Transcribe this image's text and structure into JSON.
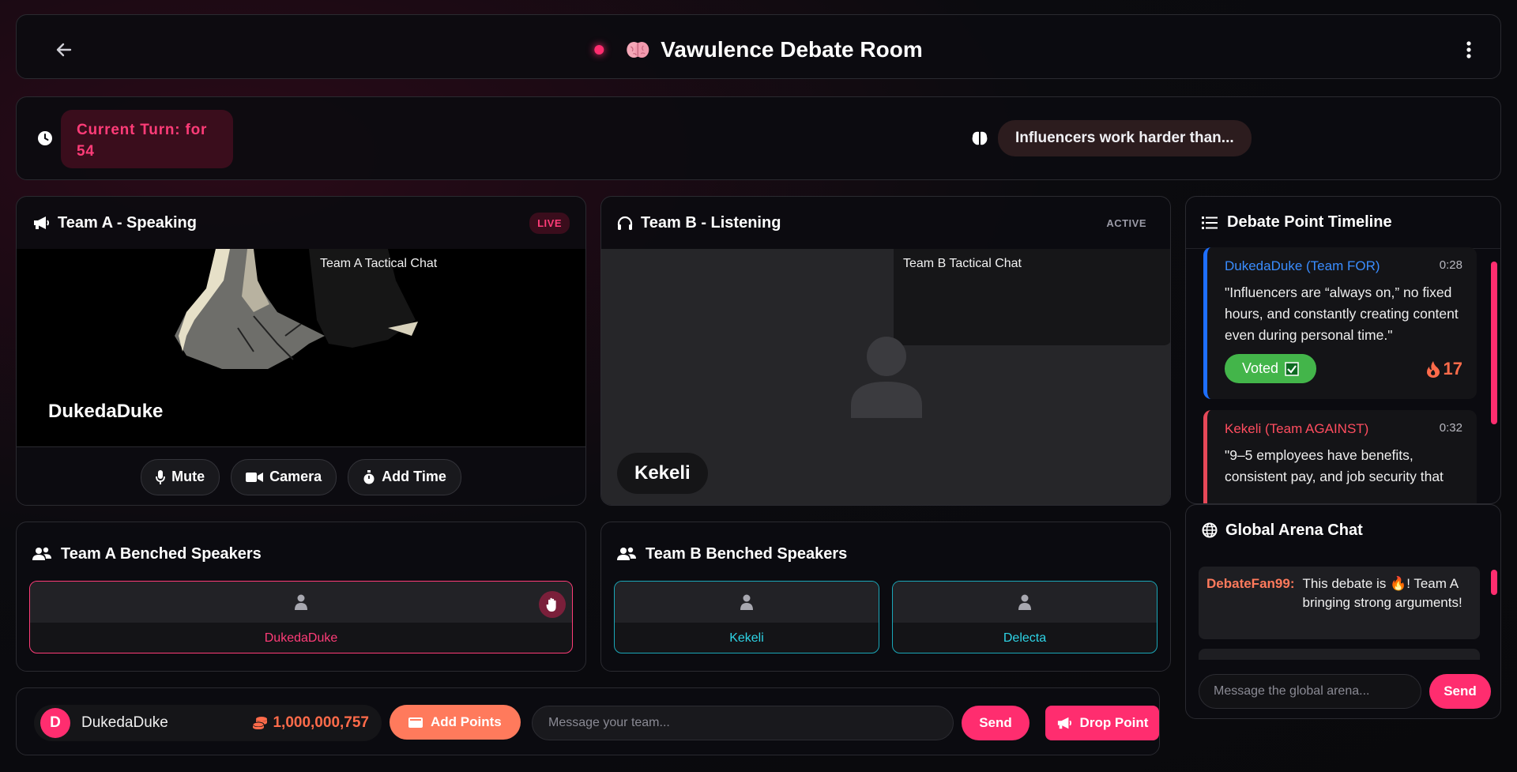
{
  "header": {
    "title": "Vawulence Debate Room",
    "title_icon": "brain-icon",
    "back_icon": "back-arrow-icon",
    "menu_icon": "more-vertical-icon",
    "live_color": "#ff2d6f"
  },
  "turn": {
    "label": "Current Turn: for",
    "seconds": "54",
    "topic": "Influencers work harder than..."
  },
  "team_a": {
    "title": "Team A - Speaking",
    "status": "LIVE",
    "tactical_label": "Team A Tactical Chat",
    "speaker": "DukedaDuke",
    "controls": {
      "mute": "Mute",
      "camera": "Camera",
      "add_time": "Add Time"
    }
  },
  "team_b": {
    "title": "Team B - Listening",
    "status": "ACTIVE",
    "tactical_label": "Team B Tactical Chat",
    "speaker": "Kekeli"
  },
  "bench_a": {
    "title": "Team A Benched Speakers",
    "speakers": [
      "DukedaDuke"
    ]
  },
  "bench_b": {
    "title": "Team B Benched Speakers",
    "speakers": [
      "Kekeli",
      "Delecta"
    ]
  },
  "bottom_bar": {
    "avatar_letter": "D",
    "username": "DukedaDuke",
    "coins": "1,000,000,757",
    "add_points": "Add Points",
    "team_message_placeholder": "Message your team...",
    "send": "Send",
    "drop_point": "Drop Point"
  },
  "timeline": {
    "title": "Debate Point Timeline",
    "items": [
      {
        "author": "DukedaDuke (Team FOR)",
        "time": "0:28",
        "quote": "\"Influencers are “always on,” no fixed hours, and constantly creating content even during personal time.\"",
        "voted": "Voted",
        "fire_count": "17"
      },
      {
        "author": "Kekeli (Team AGAINST)",
        "time": "0:32",
        "quote": "\"9–5 employees have benefits, consistent pay, and job security that"
      }
    ]
  },
  "global_chat": {
    "title": "Global Arena Chat",
    "messages": [
      {
        "user": "DebateFan99:",
        "text": "This debate is 🔥! Team A bringing strong arguments!"
      }
    ],
    "placeholder": "Message the global arena...",
    "send": "Send"
  },
  "colors": {
    "accent": "#ff2d6f",
    "coin": "#ff6b4a",
    "team_for": "#3a8dff",
    "team_against": "#ff4d5f",
    "teal": "#2ed4e6",
    "voted": "#43b54a"
  }
}
